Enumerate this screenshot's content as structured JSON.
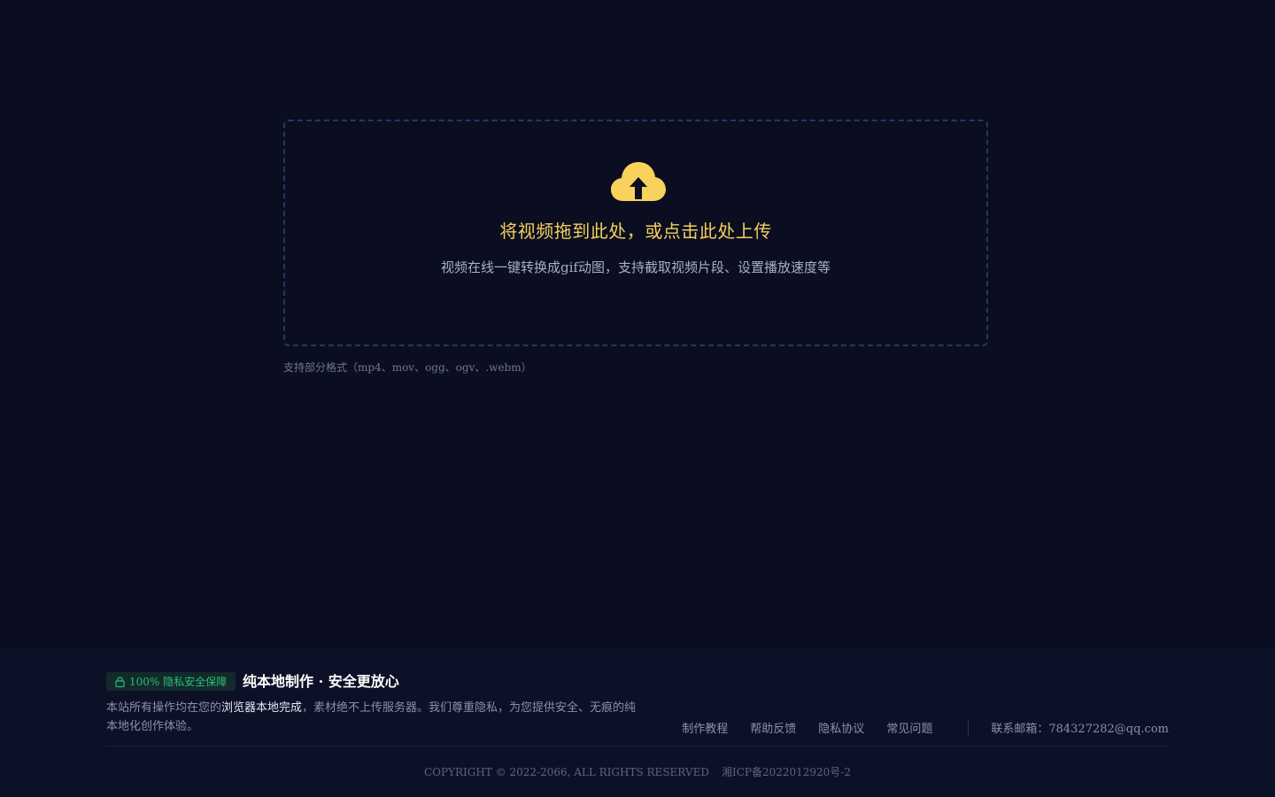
{
  "upload": {
    "title": "将视频拖到此处，或点击此处上传",
    "description": "视频在线一键转换成gif动图，支持截取视频片段、设置播放速度等",
    "formats_note": "支持部分格式（mp4、mov、ogg、ogv、.webm）",
    "icon": "cloud-upload-icon",
    "icon_color": "#f8d25c"
  },
  "footer": {
    "badge": "100% 隐私安全保障",
    "heading": "纯本地制作 · 安全更放心",
    "text_before": "本站所有操作均在您的",
    "text_highlight": "浏览器本地完成",
    "text_after": "，素材绝不上传服务器。我们尊重隐私，为您提供安全、无痕的纯本地化创作体验。",
    "links": [
      "制作教程",
      "帮助反馈",
      "隐私协议",
      "常见问题"
    ],
    "contact_label": "联系邮箱：",
    "contact_email": "784327282@qq.com",
    "copyright": "COPYRIGHT © 2022-2066, ALL RIGHTS RESERVED",
    "icp": "湘ICP备2022012920号-2",
    "badge_color": "#27c07a"
  }
}
